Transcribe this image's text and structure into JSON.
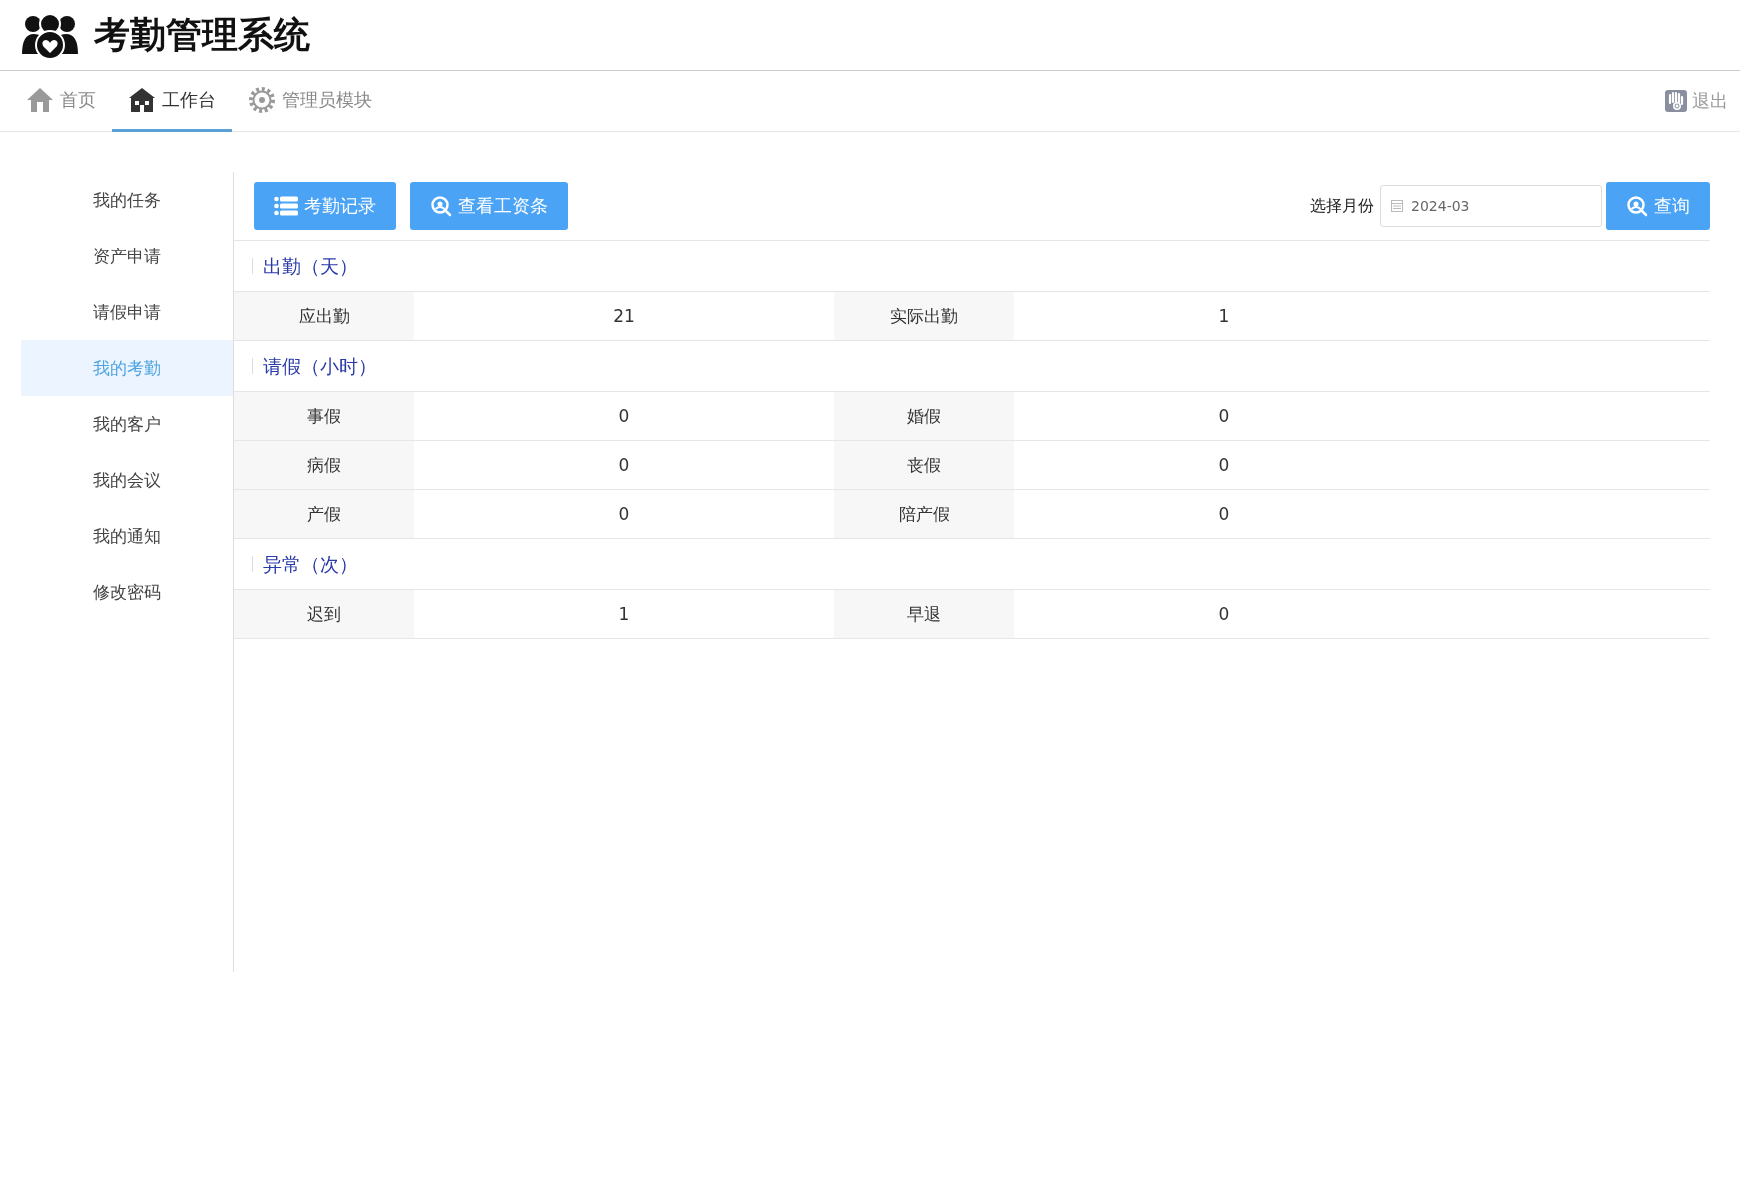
{
  "app_title": "考勤管理系统",
  "nav_tabs": [
    {
      "label": "首页",
      "kind": "house",
      "selected": false
    },
    {
      "label": "工作台",
      "kind": "office",
      "selected": true
    },
    {
      "label": "管理员模块",
      "kind": "gear",
      "selected": false
    }
  ],
  "logout": "退出",
  "sidebar": {
    "items": [
      {
        "label": "我的任务",
        "selected": false
      },
      {
        "label": "资产申请",
        "selected": false
      },
      {
        "label": "请假申请",
        "selected": false
      },
      {
        "label": "我的考勤",
        "selected": true
      },
      {
        "label": "我的客户",
        "selected": false
      },
      {
        "label": "我的会议",
        "selected": false
      },
      {
        "label": "我的通知",
        "selected": false
      },
      {
        "label": "修改密码",
        "selected": false
      }
    ]
  },
  "toolbar": {
    "buttons": [
      {
        "label": "考勤记录",
        "kind": "list"
      },
      {
        "label": "查看工资条",
        "kind": "search"
      }
    ],
    "month_label": "选择月份",
    "month_value": "2024-03",
    "query_button": "查询"
  },
  "sections": [
    {
      "title": "出勤（天）",
      "rows": [
        [
          {
            "label": "应出勤",
            "value": "21"
          },
          {
            "label": "实际出勤",
            "value": "1"
          }
        ]
      ]
    },
    {
      "title": "请假（小时）",
      "rows": [
        [
          {
            "label": "事假",
            "value": "0"
          },
          {
            "label": "婚假",
            "value": "0"
          }
        ],
        [
          {
            "label": "病假",
            "value": "0"
          },
          {
            "label": "丧假",
            "value": "0"
          }
        ],
        [
          {
            "label": "产假",
            "value": "0"
          },
          {
            "label": "陪产假",
            "value": "0"
          }
        ]
      ]
    },
    {
      "title": "异常（次）",
      "rows": [
        [
          {
            "label": "迟到",
            "value": "1"
          },
          {
            "label": "早退",
            "value": "0"
          }
        ]
      ]
    }
  ]
}
